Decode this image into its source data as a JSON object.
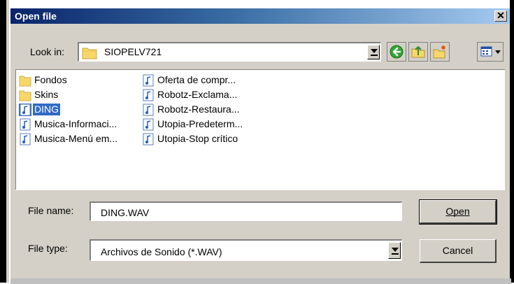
{
  "window": {
    "title": "Open file"
  },
  "look_in": {
    "label": "Look in:",
    "value": "SIOPELV721"
  },
  "toolbar": {
    "icons": [
      "back-icon",
      "up-folder-icon",
      "new-folder-icon",
      "view-menu-icon"
    ]
  },
  "files": [
    {
      "name": "Fondos",
      "type": "folder"
    },
    {
      "name": "Skins",
      "type": "folder"
    },
    {
      "name": "DING",
      "type": "audio",
      "selected": true
    },
    {
      "name": "Musica-Informaci...",
      "type": "audio"
    },
    {
      "name": "Musica-Menú em...",
      "type": "audio"
    },
    {
      "name": "Oferta de compr...",
      "type": "audio"
    },
    {
      "name": "Robotz-Exclama...",
      "type": "audio"
    },
    {
      "name": "Robotz-Restaura...",
      "type": "audio"
    },
    {
      "name": "Utopia-Predeterm...",
      "type": "audio"
    },
    {
      "name": "Utopia-Stop crítico",
      "type": "audio"
    }
  ],
  "file_name": {
    "label": "File name:",
    "value": "DING.WAV"
  },
  "file_type": {
    "label": "File type:",
    "value": "Archivos de Sonido (*.WAV)"
  },
  "buttons": {
    "open": "Open",
    "cancel": "Cancel"
  },
  "colors": {
    "title_start": "#0a246a",
    "title_end": "#a6caf0",
    "selection": "#316ac5",
    "face": "#d4d0c8"
  }
}
